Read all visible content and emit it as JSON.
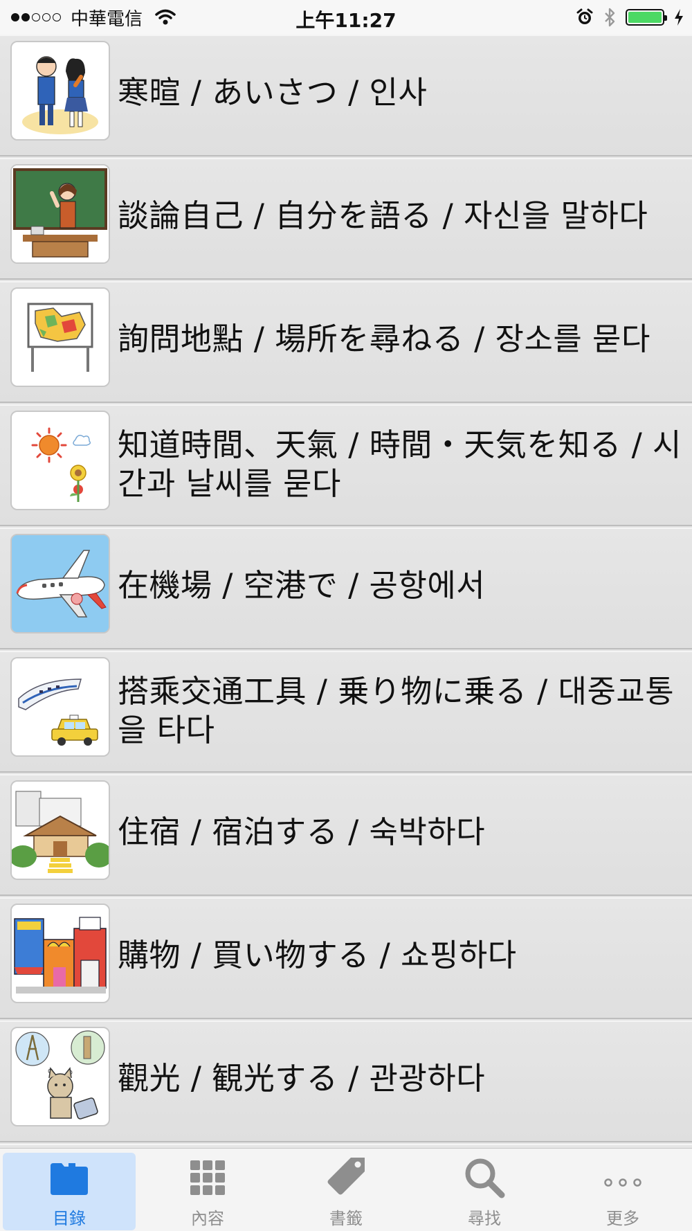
{
  "status_bar": {
    "carrier": "中華電信",
    "time": "上午11:27",
    "icons": [
      "signal-dots",
      "wifi-icon",
      "alarm-icon",
      "bluetooth-icon",
      "battery-icon",
      "charging-icon"
    ],
    "battery_level": 1.0,
    "battery_color": "#4cd964"
  },
  "list": {
    "items": [
      {
        "label": "寒暄 / あいさつ / 인사",
        "icon": "greeting-students-illustration"
      },
      {
        "label": "談論自己 / 自分を語る / 자신을 말하다",
        "icon": "teacher-blackboard-illustration"
      },
      {
        "label": "詢問地點 / 場所を尋ねる / 장소를 묻다",
        "icon": "map-board-illustration"
      },
      {
        "label": "知道時間、天氣 / 時間・天気を知る / 시간과 날씨를 묻다",
        "icon": "sun-flower-weather-illustration"
      },
      {
        "label": "在機場 / 空港で / 공항에서",
        "icon": "airplane-illustration"
      },
      {
        "label": "搭乘交通工具 / 乗り物に乗る / 대중교통을 타다",
        "icon": "train-taxi-illustration"
      },
      {
        "label": "住宿 / 宿泊する / 숙박하다",
        "icon": "inn-building-illustration"
      },
      {
        "label": "購物 / 買い物する / 쇼핑하다",
        "icon": "shop-street-illustration"
      },
      {
        "label": "觀光 / 観光する / 관광하다",
        "icon": "cat-travel-illustration"
      }
    ]
  },
  "tab_bar": {
    "tabs": [
      {
        "label": "目錄",
        "icon": "folder-icon",
        "active": true
      },
      {
        "label": "內容",
        "icon": "grid-icon",
        "active": false
      },
      {
        "label": "書籤",
        "icon": "tag-icon",
        "active": false
      },
      {
        "label": "尋找",
        "icon": "search-icon",
        "active": false
      },
      {
        "label": "更多",
        "icon": "more-dots-icon",
        "active": false
      }
    ],
    "active_color": "#1f7ae0",
    "active_bg": "#cfe3fb",
    "inactive_color": "#8e8e8e"
  }
}
